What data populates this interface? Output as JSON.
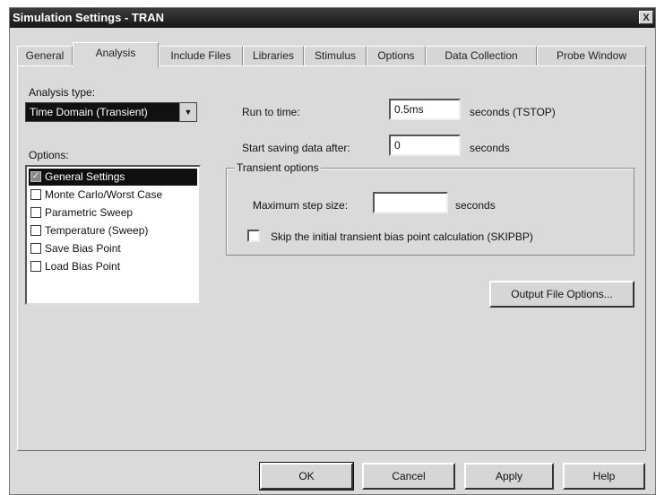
{
  "window": {
    "title": "Simulation Settings - TRAN",
    "close_glyph": "X"
  },
  "tabs": [
    {
      "label": "General"
    },
    {
      "label": "Analysis"
    },
    {
      "label": "Include Files"
    },
    {
      "label": "Libraries"
    },
    {
      "label": "Stimulus"
    },
    {
      "label": "Options"
    },
    {
      "label": "Data Collection"
    },
    {
      "label": "Probe Window"
    }
  ],
  "active_tab": "Analysis",
  "analysis": {
    "type_label": "Analysis type:",
    "type_value": "Time Domain (Transient)",
    "options_label": "Options:",
    "options": [
      {
        "label": "General Settings",
        "checked": true,
        "selected": true
      },
      {
        "label": "Monte Carlo/Worst Case",
        "checked": false
      },
      {
        "label": "Parametric Sweep",
        "checked": false
      },
      {
        "label": "Temperature (Sweep)",
        "checked": false
      },
      {
        "label": "Save Bias Point",
        "checked": false
      },
      {
        "label": "Load Bias Point",
        "checked": false
      }
    ]
  },
  "settings": {
    "run_to_time_label": "Run to time:",
    "run_to_time_value": "0.5ms",
    "run_to_time_unit": "seconds  (TSTOP)",
    "start_saving_label": "Start saving data after:",
    "start_saving_value": "0",
    "start_saving_unit": "seconds",
    "transient_group_label": "Transient options",
    "max_step_label": "Maximum step size:",
    "max_step_value": "",
    "max_step_unit": "seconds",
    "skip_bias_label": "Skip the initial transient bias point calculation  (SKIPBP)",
    "skip_bias_checked": false,
    "output_file_button": "Output File Options..."
  },
  "footer": {
    "ok": "OK",
    "cancel": "Cancel",
    "apply": "Apply",
    "help": "Help"
  }
}
